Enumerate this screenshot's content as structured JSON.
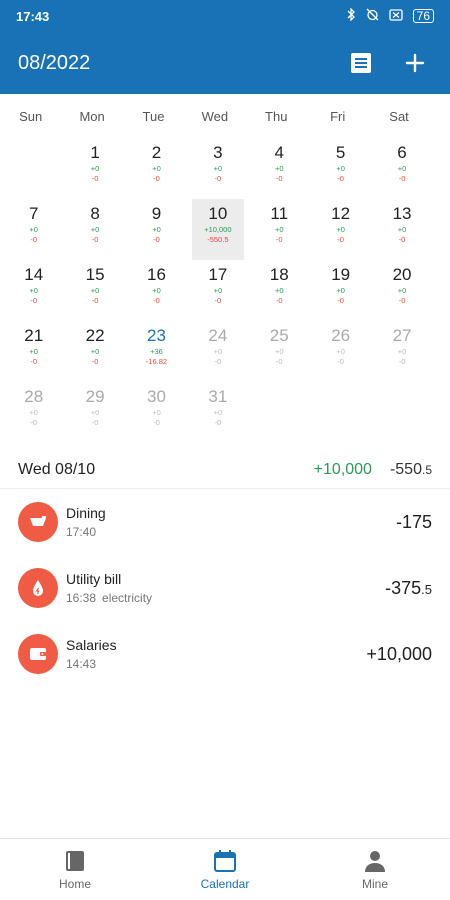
{
  "status": {
    "time": "17:43",
    "battery": "76"
  },
  "header": {
    "title": "08/2022"
  },
  "weekdays": [
    "Sun",
    "Mon",
    "Tue",
    "Wed",
    "Thu",
    "Fri",
    "Sat"
  ],
  "days": [
    {
      "n": "1",
      "inc": "+0",
      "exp": "-0"
    },
    {
      "n": "2",
      "inc": "+0",
      "exp": "-0"
    },
    {
      "n": "3",
      "inc": "+0",
      "exp": "-0"
    },
    {
      "n": "4",
      "inc": "+0",
      "exp": "-0"
    },
    {
      "n": "5",
      "inc": "+0",
      "exp": "-0"
    },
    {
      "n": "6",
      "inc": "+0",
      "exp": "-0"
    },
    {
      "n": "7",
      "inc": "+0",
      "exp": "-0"
    },
    {
      "n": "8",
      "inc": "+0",
      "exp": "-0"
    },
    {
      "n": "9",
      "inc": "+0",
      "exp": "-0"
    },
    {
      "n": "10",
      "inc": "+10,000",
      "exp": "-550.5"
    },
    {
      "n": "11",
      "inc": "+0",
      "exp": "-0"
    },
    {
      "n": "12",
      "inc": "+0",
      "exp": "-0"
    },
    {
      "n": "13",
      "inc": "+0",
      "exp": "-0"
    },
    {
      "n": "14",
      "inc": "+0",
      "exp": "-0"
    },
    {
      "n": "15",
      "inc": "+0",
      "exp": "-0"
    },
    {
      "n": "16",
      "inc": "+0",
      "exp": "-0"
    },
    {
      "n": "17",
      "inc": "+0",
      "exp": "-0"
    },
    {
      "n": "18",
      "inc": "+0",
      "exp": "-0"
    },
    {
      "n": "19",
      "inc": "+0",
      "exp": "-0"
    },
    {
      "n": "20",
      "inc": "+0",
      "exp": "-0"
    },
    {
      "n": "21",
      "inc": "+0",
      "exp": "-0"
    },
    {
      "n": "22",
      "inc": "+0",
      "exp": "-0"
    },
    {
      "n": "23",
      "inc": "+36",
      "exp": "-16.82"
    },
    {
      "n": "24",
      "inc": "+0",
      "exp": "-0"
    },
    {
      "n": "25",
      "inc": "+0",
      "exp": "-0"
    },
    {
      "n": "26",
      "inc": "+0",
      "exp": "-0"
    },
    {
      "n": "27",
      "inc": "+0",
      "exp": "-0"
    },
    {
      "n": "28",
      "inc": "+0",
      "exp": "-0"
    },
    {
      "n": "29",
      "inc": "+0",
      "exp": "-0"
    },
    {
      "n": "30",
      "inc": "+0",
      "exp": "-0"
    },
    {
      "n": "31",
      "inc": "+0",
      "exp": "-0"
    }
  ],
  "selected": {
    "title": "Wed 08/10",
    "income": "+10,000",
    "expense_main": "-550",
    "expense_dec": ".5"
  },
  "transactions": [
    {
      "name": "Dining",
      "time": "17:40",
      "note": "",
      "amount_main": "-175",
      "amount_dec": "",
      "icon": "dining-icon"
    },
    {
      "name": "Utility bill",
      "time": "16:38",
      "note": "electricity",
      "amount_main": "-375",
      "amount_dec": ".5",
      "icon": "utility-icon"
    },
    {
      "name": "Salaries",
      "time": "14:43",
      "note": "",
      "amount_main": "+10,000",
      "amount_dec": "",
      "icon": "wallet-icon"
    }
  ],
  "nav": [
    {
      "label": "Home",
      "icon": "book-icon"
    },
    {
      "label": "Calendar",
      "icon": "calendar-icon"
    },
    {
      "label": "Mine",
      "icon": "person-icon"
    }
  ],
  "colors": {
    "primary": "#1872b5",
    "income": "#2a9a57",
    "expense": "#e04a3a",
    "icon_bg": "#ef5b45"
  }
}
